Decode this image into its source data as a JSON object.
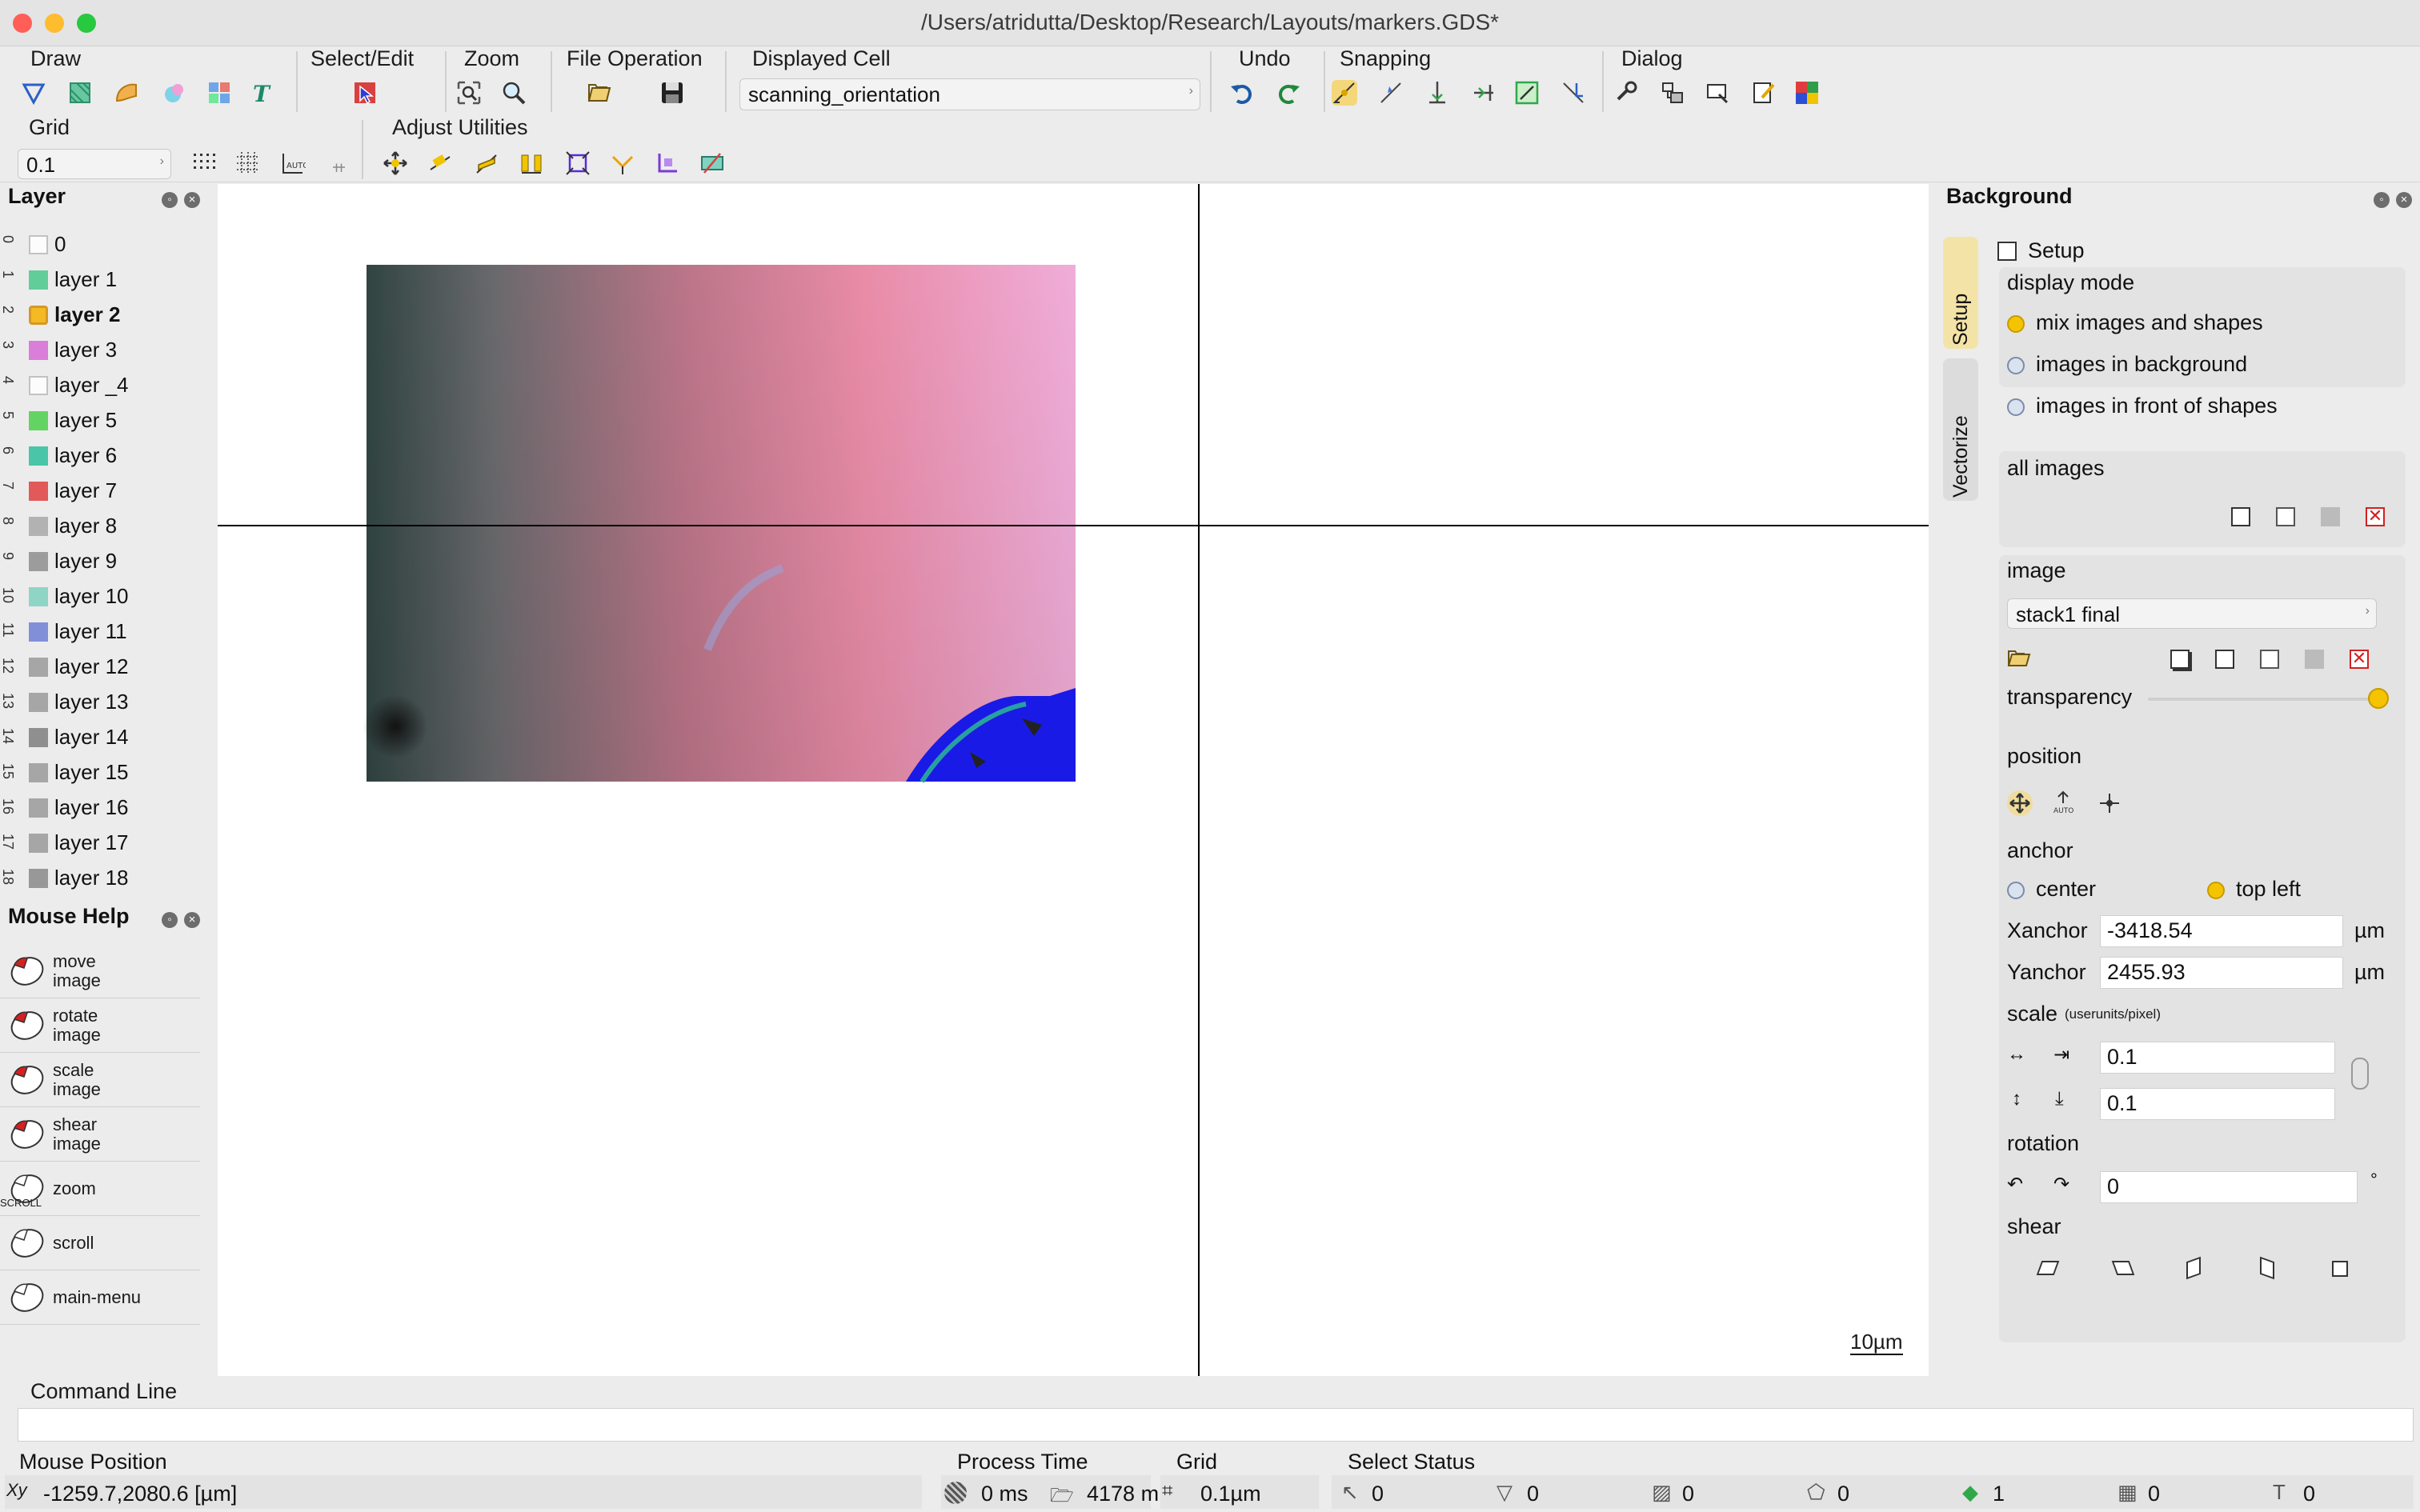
{
  "window": {
    "title": "/Users/atridutta/Desktop/Research/Layouts/markers.GDS*"
  },
  "toolbar": {
    "groups": {
      "draw": "Draw",
      "select_edit": "Select/Edit",
      "zoom": "Zoom",
      "file_operation": "File Operation",
      "displayed_cell": "Displayed Cell",
      "undo": "Undo",
      "snapping": "Snapping",
      "dialog": "Dialog",
      "grid": "Grid",
      "adjust_utilities": "Adjust Utilities"
    },
    "displayed_cell_value": "scanning_orientation",
    "grid_value": "0.1"
  },
  "layer_panel": {
    "title": "Layer",
    "layers": [
      {
        "num": "0",
        "name": "0",
        "color": "#ffffff"
      },
      {
        "num": "1",
        "name": "layer 1",
        "color": "#49c98b"
      },
      {
        "num": "2",
        "name": "layer 2",
        "color": "#f5b200",
        "selected": true
      },
      {
        "num": "3",
        "name": "layer 3",
        "color": "#d66bd6"
      },
      {
        "num": "4",
        "name": "layer _4",
        "color": "#ffffff"
      },
      {
        "num": "5",
        "name": "layer 5",
        "color": "#4ccf4c"
      },
      {
        "num": "6",
        "name": "layer 6",
        "color": "#2fbf9b"
      },
      {
        "num": "7",
        "name": "layer 7",
        "color": "#e04040"
      },
      {
        "num": "8",
        "name": "layer 8",
        "color": "#a8a8a8"
      },
      {
        "num": "9",
        "name": "layer 9",
        "color": "#8f8f8f"
      },
      {
        "num": "10",
        "name": "layer 10",
        "color": "#7fd2bf"
      },
      {
        "num": "11",
        "name": "layer 11",
        "color": "#6f7fd6"
      },
      {
        "num": "12",
        "name": "layer 12",
        "color": "#9a9a9a"
      },
      {
        "num": "13",
        "name": "layer 13",
        "color": "#9a9a9a"
      },
      {
        "num": "14",
        "name": "layer 14",
        "color": "#7f7f7f"
      },
      {
        "num": "15",
        "name": "layer 15",
        "color": "#9a9a9a"
      },
      {
        "num": "16",
        "name": "layer 16",
        "color": "#9a9a9a"
      },
      {
        "num": "17",
        "name": "layer 17",
        "color": "#9a9a9a"
      },
      {
        "num": "18",
        "name": "layer 18",
        "color": "#8a8a8a"
      }
    ]
  },
  "mouse_help": {
    "title": "Mouse Help",
    "items": [
      {
        "line1": "move",
        "line2": "image"
      },
      {
        "line1": "rotate",
        "line2": "image"
      },
      {
        "line1": "scale",
        "line2": "image"
      },
      {
        "line1": "shear",
        "line2": "image"
      },
      {
        "line1": "zoom",
        "line2": ""
      },
      {
        "line1": "scroll",
        "line2": ""
      },
      {
        "line1": "main-menu",
        "line2": ""
      }
    ],
    "scroll_tag": "SCROLL"
  },
  "canvas": {
    "scale_bar": "10µm"
  },
  "background_panel": {
    "title": "Background",
    "tabs": [
      "Setup",
      "Vectorize"
    ],
    "setup_label": "Setup",
    "display_mode": {
      "title": "display mode",
      "options": [
        "mix images and shapes",
        "images in background",
        "images in front of shapes"
      ],
      "selected": 0
    },
    "all_images_title": "all images",
    "image": {
      "title": "image",
      "selected": "stack1 final",
      "transparency_label": "transparency",
      "transparency": 1.0
    },
    "position": {
      "title": "position",
      "anchor_label": "anchor",
      "anchor_options": [
        "center",
        "top left"
      ],
      "anchor_selected": 1,
      "xanchor_label": "Xanchor",
      "xanchor": "-3418.54",
      "yanchor_label": "Yanchor",
      "yanchor": "2455.93",
      "unit": "µm",
      "scale_label": "scale",
      "scale_units": "(userunits/pixel)",
      "scale_x": "0.1",
      "scale_y": "0.1",
      "rotation_label": "rotation",
      "rotation": "0",
      "degree": "°",
      "shear_label": "shear"
    }
  },
  "command_line": {
    "title": "Command Line"
  },
  "status": {
    "mouse_position_label": "Mouse Position",
    "mouse_position": "-1259.7,2080.6 [µm]",
    "process_time_label": "Process Time",
    "process_time": "0 ms",
    "memory": "4178 m",
    "grid_label": "Grid",
    "grid": "0.1µm",
    "select_status_label": "Select Status",
    "select_counts": [
      "0",
      "0",
      "0",
      "0",
      "1",
      "0",
      "0"
    ]
  },
  "colors": {
    "accent_yellow": "#f5c400",
    "crosshair": "#000000",
    "image_pink": "#f59bb8",
    "image_blue": "#1a1ae6"
  }
}
